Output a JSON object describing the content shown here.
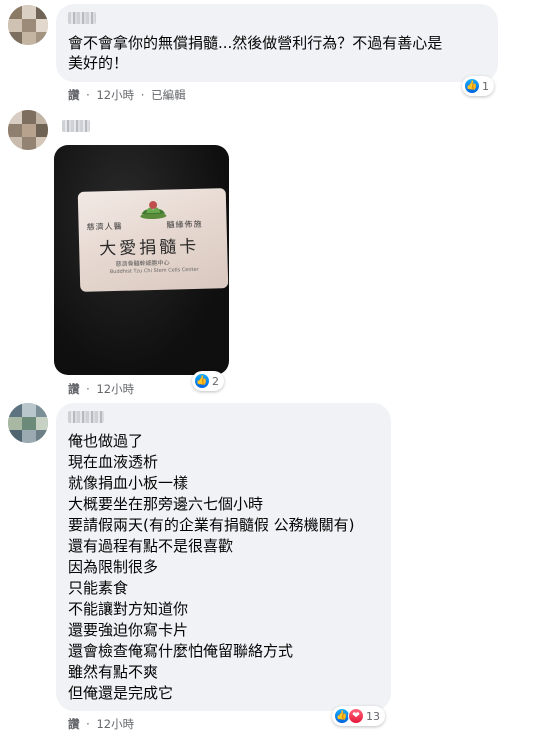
{
  "comments": [
    {
      "text_lines": [
        "會不會拿你的無償捐髓...然後做營利行為？不過有善心是",
        "美好的！"
      ],
      "actions": {
        "like": "讚",
        "dot1": "·",
        "time": "12小時",
        "dot2": "·",
        "edited": "已編輯"
      },
      "reactions": {
        "count": "1"
      }
    },
    {
      "image": {
        "card_line1_left": "慈濟人醫",
        "card_line1_right": "髓緣佈施",
        "card_title": "大愛捐髓卡",
        "card_org": "慈濟骨髓幹細胞中心",
        "card_org_en": "Buddhist Tzu Chi Stem Cells Center"
      },
      "actions": {
        "like": "讚",
        "dot1": "·",
        "time": "12小時"
      },
      "reactions": {
        "count": "2"
      }
    },
    {
      "text_lines": [
        "俺也做過了",
        "現在血液透析",
        "就像捐血小板一樣",
        "大概要坐在那旁邊六七個小時",
        "要請假兩天(有的企業有捐髓假 公務機關有)",
        "還有過程有點不是很喜歡",
        "因為限制很多",
        "只能素食",
        "不能讓對方知道你",
        "還要強迫你寫卡片",
        "還會檢查俺寫什麼怕俺留聯絡方式",
        "雖然有點不爽",
        "但俺還是完成它"
      ],
      "actions": {
        "like": "讚",
        "dot1": "·",
        "time": "12小時"
      },
      "reactions": {
        "count": "13"
      }
    }
  ],
  "colors": {
    "bubble": "#f0f2f5",
    "meta": "#65676b",
    "like_blue": "#1877f2",
    "love_red": "#f33e58"
  },
  "icons": {
    "like": "thumbs-up-icon",
    "love": "heart-icon"
  }
}
